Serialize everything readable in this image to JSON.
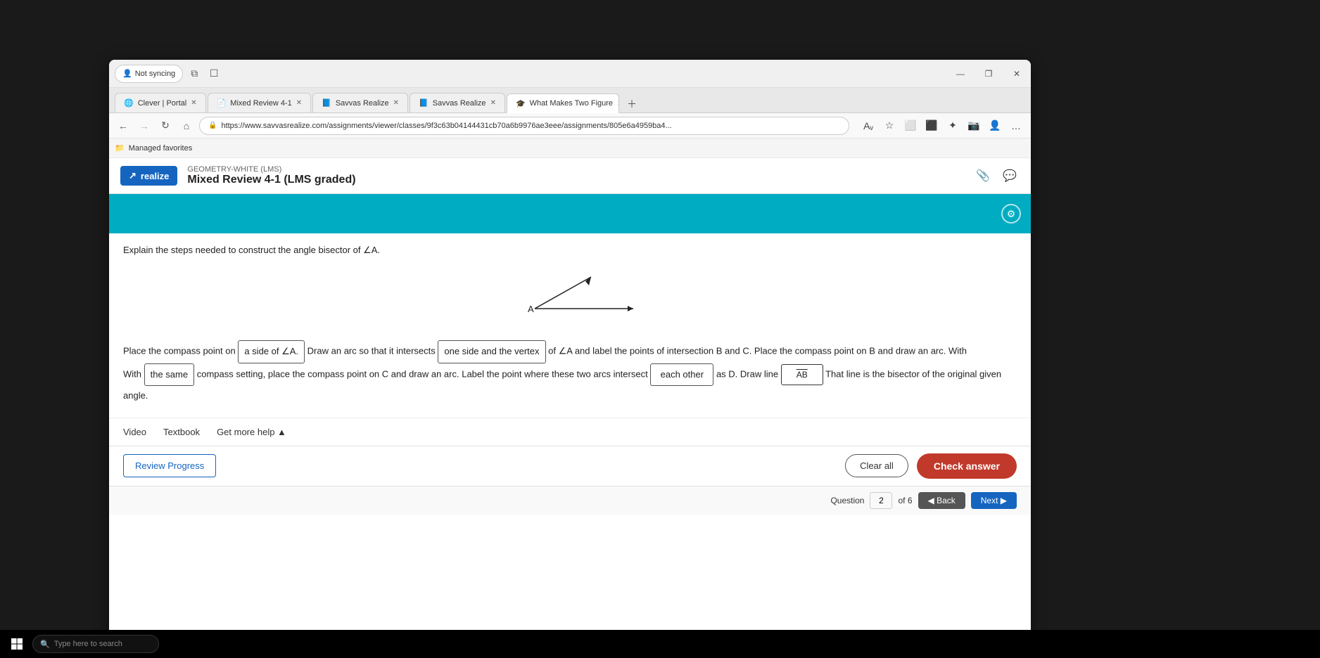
{
  "browser": {
    "not_syncing_label": "Not syncing",
    "address": "https://www.savvasrealize.com/assignments/viewer/classes/9f3c63b04144431cb70a6b9976ae3eee/assignments/805e6a4959ba4...",
    "favorites_label": "Managed favorites",
    "tabs": [
      {
        "label": "Clever | Portal",
        "active": false
      },
      {
        "label": "Mixed Review 4-1",
        "active": false
      },
      {
        "label": "Savvas Realize",
        "active": false
      },
      {
        "label": "Savvas Realize",
        "active": false
      },
      {
        "label": "What Makes Two Figure",
        "active": true
      }
    ],
    "win_min": "—",
    "win_restore": "❐",
    "win_close": "✕"
  },
  "savvas": {
    "logo_label": "realize",
    "course": "GEOMETRY-WHITE (LMS)",
    "title": "Mixed Review 4-1 (LMS graded)"
  },
  "question": {
    "prompt": "Explain the steps needed to construct the angle bisector of ∠A.",
    "angle_label": "A",
    "fill_text_1": "Place the compass point on",
    "fill_box_1": "a side of ∠A.",
    "fill_text_2": "Draw an arc so that it intersects",
    "fill_box_2": "one side and the vertex",
    "fill_text_3": "of ∠A and label the points of intersection B and C. Place the compass point on B and draw an arc. With",
    "fill_box_3": "the same",
    "fill_text_4": "compass setting, place the compass point on C and draw an arc. Label the point where these two arcs intersect",
    "fill_box_4": "each other",
    "fill_text_5": "as D. Draw line",
    "fill_box_5": "AB",
    "fill_text_6": "That line is the bisector of the original given angle."
  },
  "help": {
    "video": "Video",
    "textbook": "Textbook",
    "get_more_help": "Get more help ▲"
  },
  "actions": {
    "review_progress": "Review Progress",
    "clear_all": "Clear all",
    "check_answer": "Check answer"
  },
  "navigation": {
    "question_label": "Question",
    "current": "2",
    "total_label": "of 6",
    "back": "◀ Back",
    "next": "Next ▶"
  },
  "taskbar": {
    "search_placeholder": "Type here to search"
  },
  "icons": {
    "back_arrow": "←",
    "refresh": "↻",
    "home": "⌂",
    "lock": "🔒",
    "star": "☆",
    "settings": "⚙",
    "extensions": "⬜",
    "profile": "👤",
    "pin": "📌",
    "comment": "💬",
    "search": "🔍",
    "windows_logo": "⊞"
  }
}
